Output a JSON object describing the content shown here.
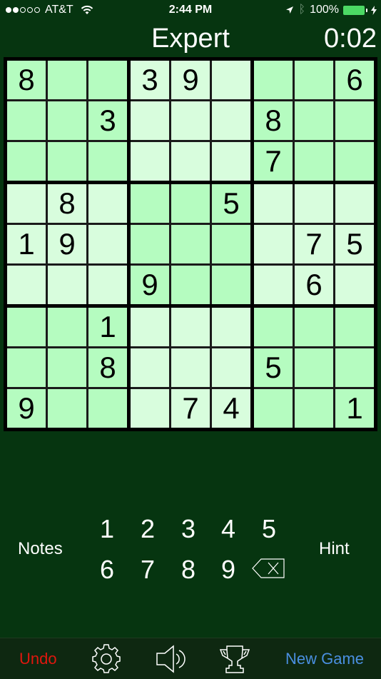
{
  "status_bar": {
    "signal_bars_filled": 2,
    "signal_bars_total": 5,
    "carrier": "AT&T",
    "time": "2:44 PM",
    "battery": "100%",
    "icons": [
      "wifi-icon",
      "location-arrow-icon",
      "bluetooth-icon",
      "battery-icon",
      "charging-bolt-icon"
    ]
  },
  "header": {
    "difficulty": "Expert",
    "timer": "0:02"
  },
  "board": {
    "rows": [
      [
        "8",
        "",
        "",
        "3",
        "9",
        "",
        "",
        "",
        "6"
      ],
      [
        "",
        "",
        "3",
        "",
        "",
        "",
        "8",
        "",
        ""
      ],
      [
        "",
        "",
        "",
        "",
        "",
        "",
        "7",
        "",
        ""
      ],
      [
        "",
        "8",
        "",
        "",
        "",
        "5",
        "",
        "",
        ""
      ],
      [
        "1",
        "9",
        "",
        "",
        "",
        "",
        "",
        "7",
        "5"
      ],
      [
        "",
        "",
        "",
        "9",
        "",
        "",
        "",
        "6",
        ""
      ],
      [
        "",
        "",
        "1",
        "",
        "",
        "",
        "",
        "",
        ""
      ],
      [
        "",
        "",
        "8",
        "",
        "",
        "",
        "5",
        "",
        ""
      ],
      [
        "9",
        "",
        "",
        "",
        "7",
        "4",
        "",
        "",
        "1"
      ]
    ],
    "box_shading": [
      [
        "dark",
        "light",
        "dark"
      ],
      [
        "light",
        "dark",
        "light"
      ],
      [
        "dark",
        "light",
        "dark"
      ]
    ]
  },
  "pad": {
    "notes_label": "Notes",
    "hint_label": "Hint",
    "numbers": [
      "1",
      "2",
      "3",
      "4",
      "5",
      "6",
      "7",
      "8",
      "9"
    ],
    "erase_icon": "backspace-icon"
  },
  "toolbar": {
    "undo_label": "Undo",
    "new_game_label": "New Game",
    "icons": [
      "gear-icon",
      "speaker-icon",
      "trophy-icon"
    ]
  },
  "colors": {
    "background": "#063510",
    "toolbar_background": "#0e2811",
    "cell_dark": "#b5fcc0",
    "cell_light": "#d8fddd",
    "undo": "#e0170e",
    "new_game": "#4a8fe0",
    "battery": "#4cd964"
  }
}
